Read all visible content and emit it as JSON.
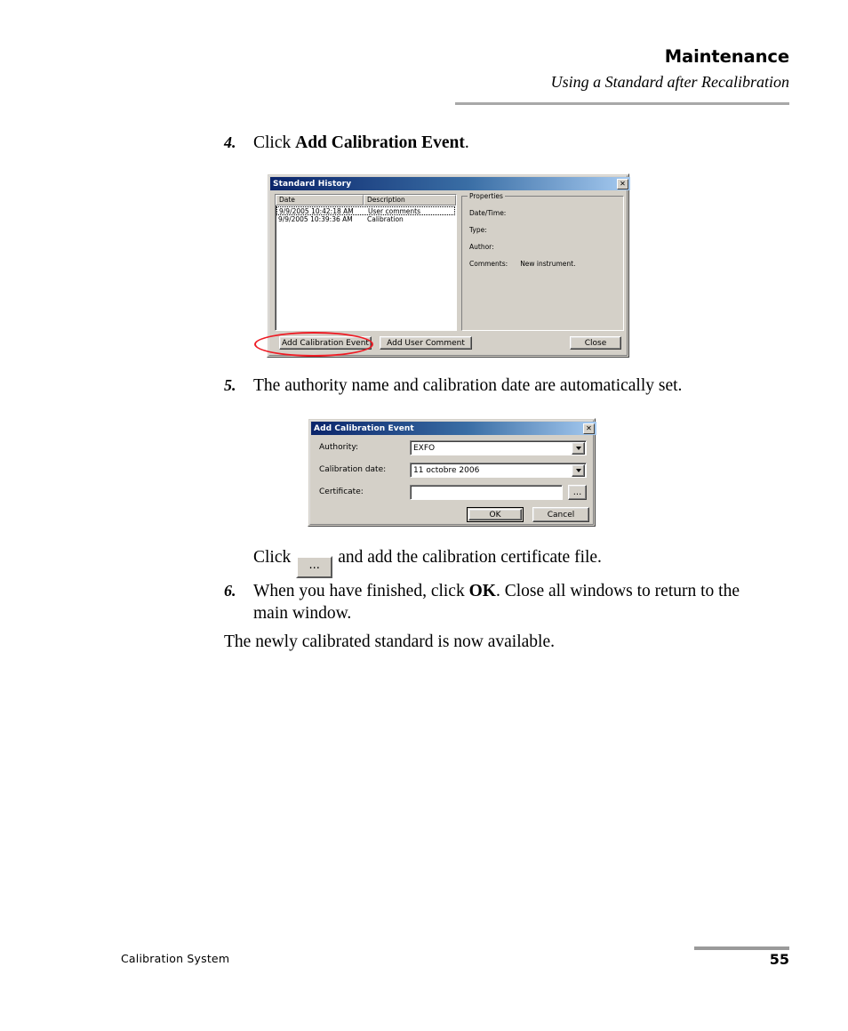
{
  "header": {
    "title": "Maintenance",
    "subtitle": "Using a Standard after Recalibration"
  },
  "steps": {
    "step4": {
      "number": "4.",
      "text_before": "Click ",
      "bold": "Add Calibration Event",
      "text_after": "."
    },
    "step5": {
      "number": "5.",
      "text": "The authority name and calibration date are automatically set."
    },
    "click_line": {
      "text_before": "Click",
      "button_label": "...",
      "text_after": "and add the calibration certificate file."
    },
    "step6": {
      "number": "6.",
      "text_before": "When you have finished, click ",
      "bold": "OK",
      "text_after": ". Close all windows to return to the main window."
    },
    "closing": "The newly calibrated standard is now available."
  },
  "standard_history_dialog": {
    "title": "Standard History",
    "close_button": "✕",
    "list": {
      "columns": [
        "Date",
        "Description"
      ],
      "rows": [
        {
          "date": "9/9/2005 10:42:18 AM",
          "description": "User comments",
          "selected": true
        },
        {
          "date": "9/9/2005 10:39:36 AM",
          "description": "Calibration",
          "selected": false
        }
      ]
    },
    "properties": {
      "legend": "Properties",
      "fields": [
        {
          "label": "Date/Time:",
          "value": ""
        },
        {
          "label": "Type:",
          "value": ""
        },
        {
          "label": "Author:",
          "value": ""
        },
        {
          "label": "Comments:",
          "value": "New instrument."
        }
      ]
    },
    "buttons": {
      "add_calibration_event": "Add Calibration Event",
      "add_user_comment": "Add User Comment",
      "close": "Close"
    }
  },
  "add_calibration_event_dialog": {
    "title": "Add Calibration Event",
    "close_button": "✕",
    "fields": {
      "authority": {
        "label": "Authority:",
        "value": "EXFO"
      },
      "calibration_date": {
        "label": "Calibration date:",
        "value": "11   octobre   2006"
      },
      "certificate": {
        "label": "Certificate:",
        "value": "",
        "browse_label": "..."
      }
    },
    "buttons": {
      "ok": "OK",
      "cancel": "Cancel"
    }
  },
  "footer": {
    "left": "Calibration System",
    "page": "55"
  },
  "colors": {
    "title_bar_start": "#0a246a",
    "title_bar_end": "#a6caf0",
    "dialog_face": "#d4d0c8",
    "annotation_red": "#ee1b24",
    "rule_gray": "#a8a8a8"
  }
}
